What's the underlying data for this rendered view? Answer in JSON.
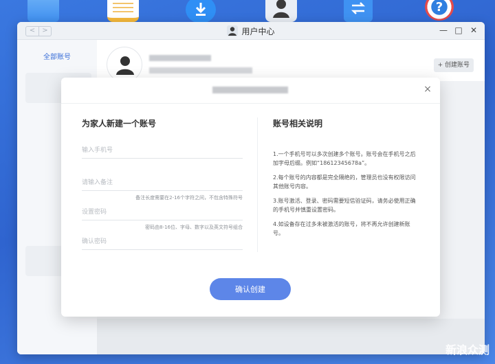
{
  "window": {
    "title": "用户中心",
    "controls": {
      "minimize": "—",
      "maximize": "□",
      "close": "✕"
    },
    "nav": {
      "back": "<",
      "forward": ">"
    }
  },
  "sidebar": {
    "items": [
      {
        "label": "全部账号"
      }
    ]
  },
  "header": {
    "create_account_label": "+ 创建账号"
  },
  "modal": {
    "close": "×",
    "left_title": "为家人新建一个账号",
    "fields": {
      "phone": {
        "placeholder": "输入手机号",
        "value": ""
      },
      "remark": {
        "placeholder": "请输入备注",
        "value": "",
        "hint": "备注长度需要在2-16个字符之间，不包含特殊符号"
      },
      "password": {
        "placeholder": "设置密码",
        "value": "",
        "hint": "密码由8-16位、字母、数字以及英文符号组合"
      },
      "confirm_password": {
        "placeholder": "确认密码",
        "value": ""
      }
    },
    "right_title": "账号相关说明",
    "info": [
      "1.一个手机号可以多次创建多个账号。账号会在手机号之后加字母后缀。例如“18612345678a”。",
      "2.每个账号的内容都是完全隔绝的，管理员也没有权限访问其他账号内容。",
      "3.账号激活、登录、密码需要短信验证码，请务必使用正确的手机号并慎重设置密码。",
      "4.如设备存在过多未被激活的账号，将不再允许创建新账号。"
    ],
    "confirm_label": "确认创建"
  },
  "watermark": "新浪众测",
  "icons": [
    "folder-icon",
    "notes-icon",
    "download-icon",
    "user-center-icon",
    "transfer-icon",
    "help-icon"
  ]
}
